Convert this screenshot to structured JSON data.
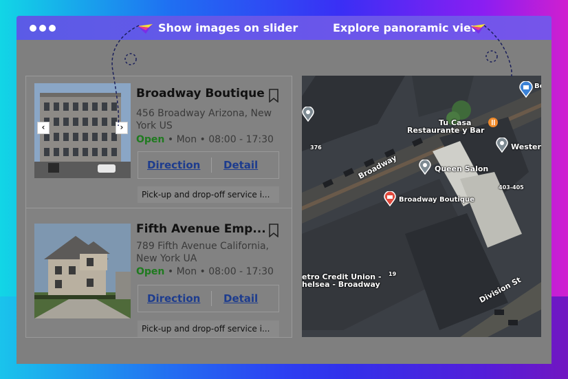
{
  "window": {
    "hint_slider": "Show images on slider",
    "hint_panorama": "Explore panoramic view"
  },
  "listings": [
    {
      "name": "Broadway Boutique",
      "address": "456 Broadway Arizona, New York US",
      "status": "Open",
      "day": "Mon",
      "hours": "08:00 - 17:30",
      "direction_label": "Direction",
      "detail_label": "Detail",
      "service": "Pick-up and drop-off service i..."
    },
    {
      "name": "Fifth Avenue Emp...",
      "address": "789 Fifth Avenue California, New York UA",
      "status": "Open",
      "day": "Mon",
      "hours": "08:00 - 17:30",
      "direction_label": "Direction",
      "detail_label": "Detail",
      "service": "Pick-up and drop-off service i..."
    }
  ],
  "slider": {
    "prev_icon": "chevron-left-icon",
    "next_icon": "chevron-right-icon"
  },
  "map": {
    "labels": {
      "tu_casa": "Tu Casa",
      "tu_casa_2": "Restaurante y Bar",
      "queen_salon": "Queen Salon",
      "western": "Western",
      "broadway_street": "Broadway",
      "broadway_boutique": "Broadway Boutique",
      "credit_union": "etro Credit Union -",
      "credit_union_2": "helsea - Broadway",
      "division_st": "Division St",
      "num_376": "376",
      "num_403": "403-405",
      "num_19": "19",
      "bo": "Bo"
    }
  },
  "colors": {
    "titlebar": "#6158e8",
    "open_status": "#1f7a1f",
    "link": "#1d3c8e"
  }
}
